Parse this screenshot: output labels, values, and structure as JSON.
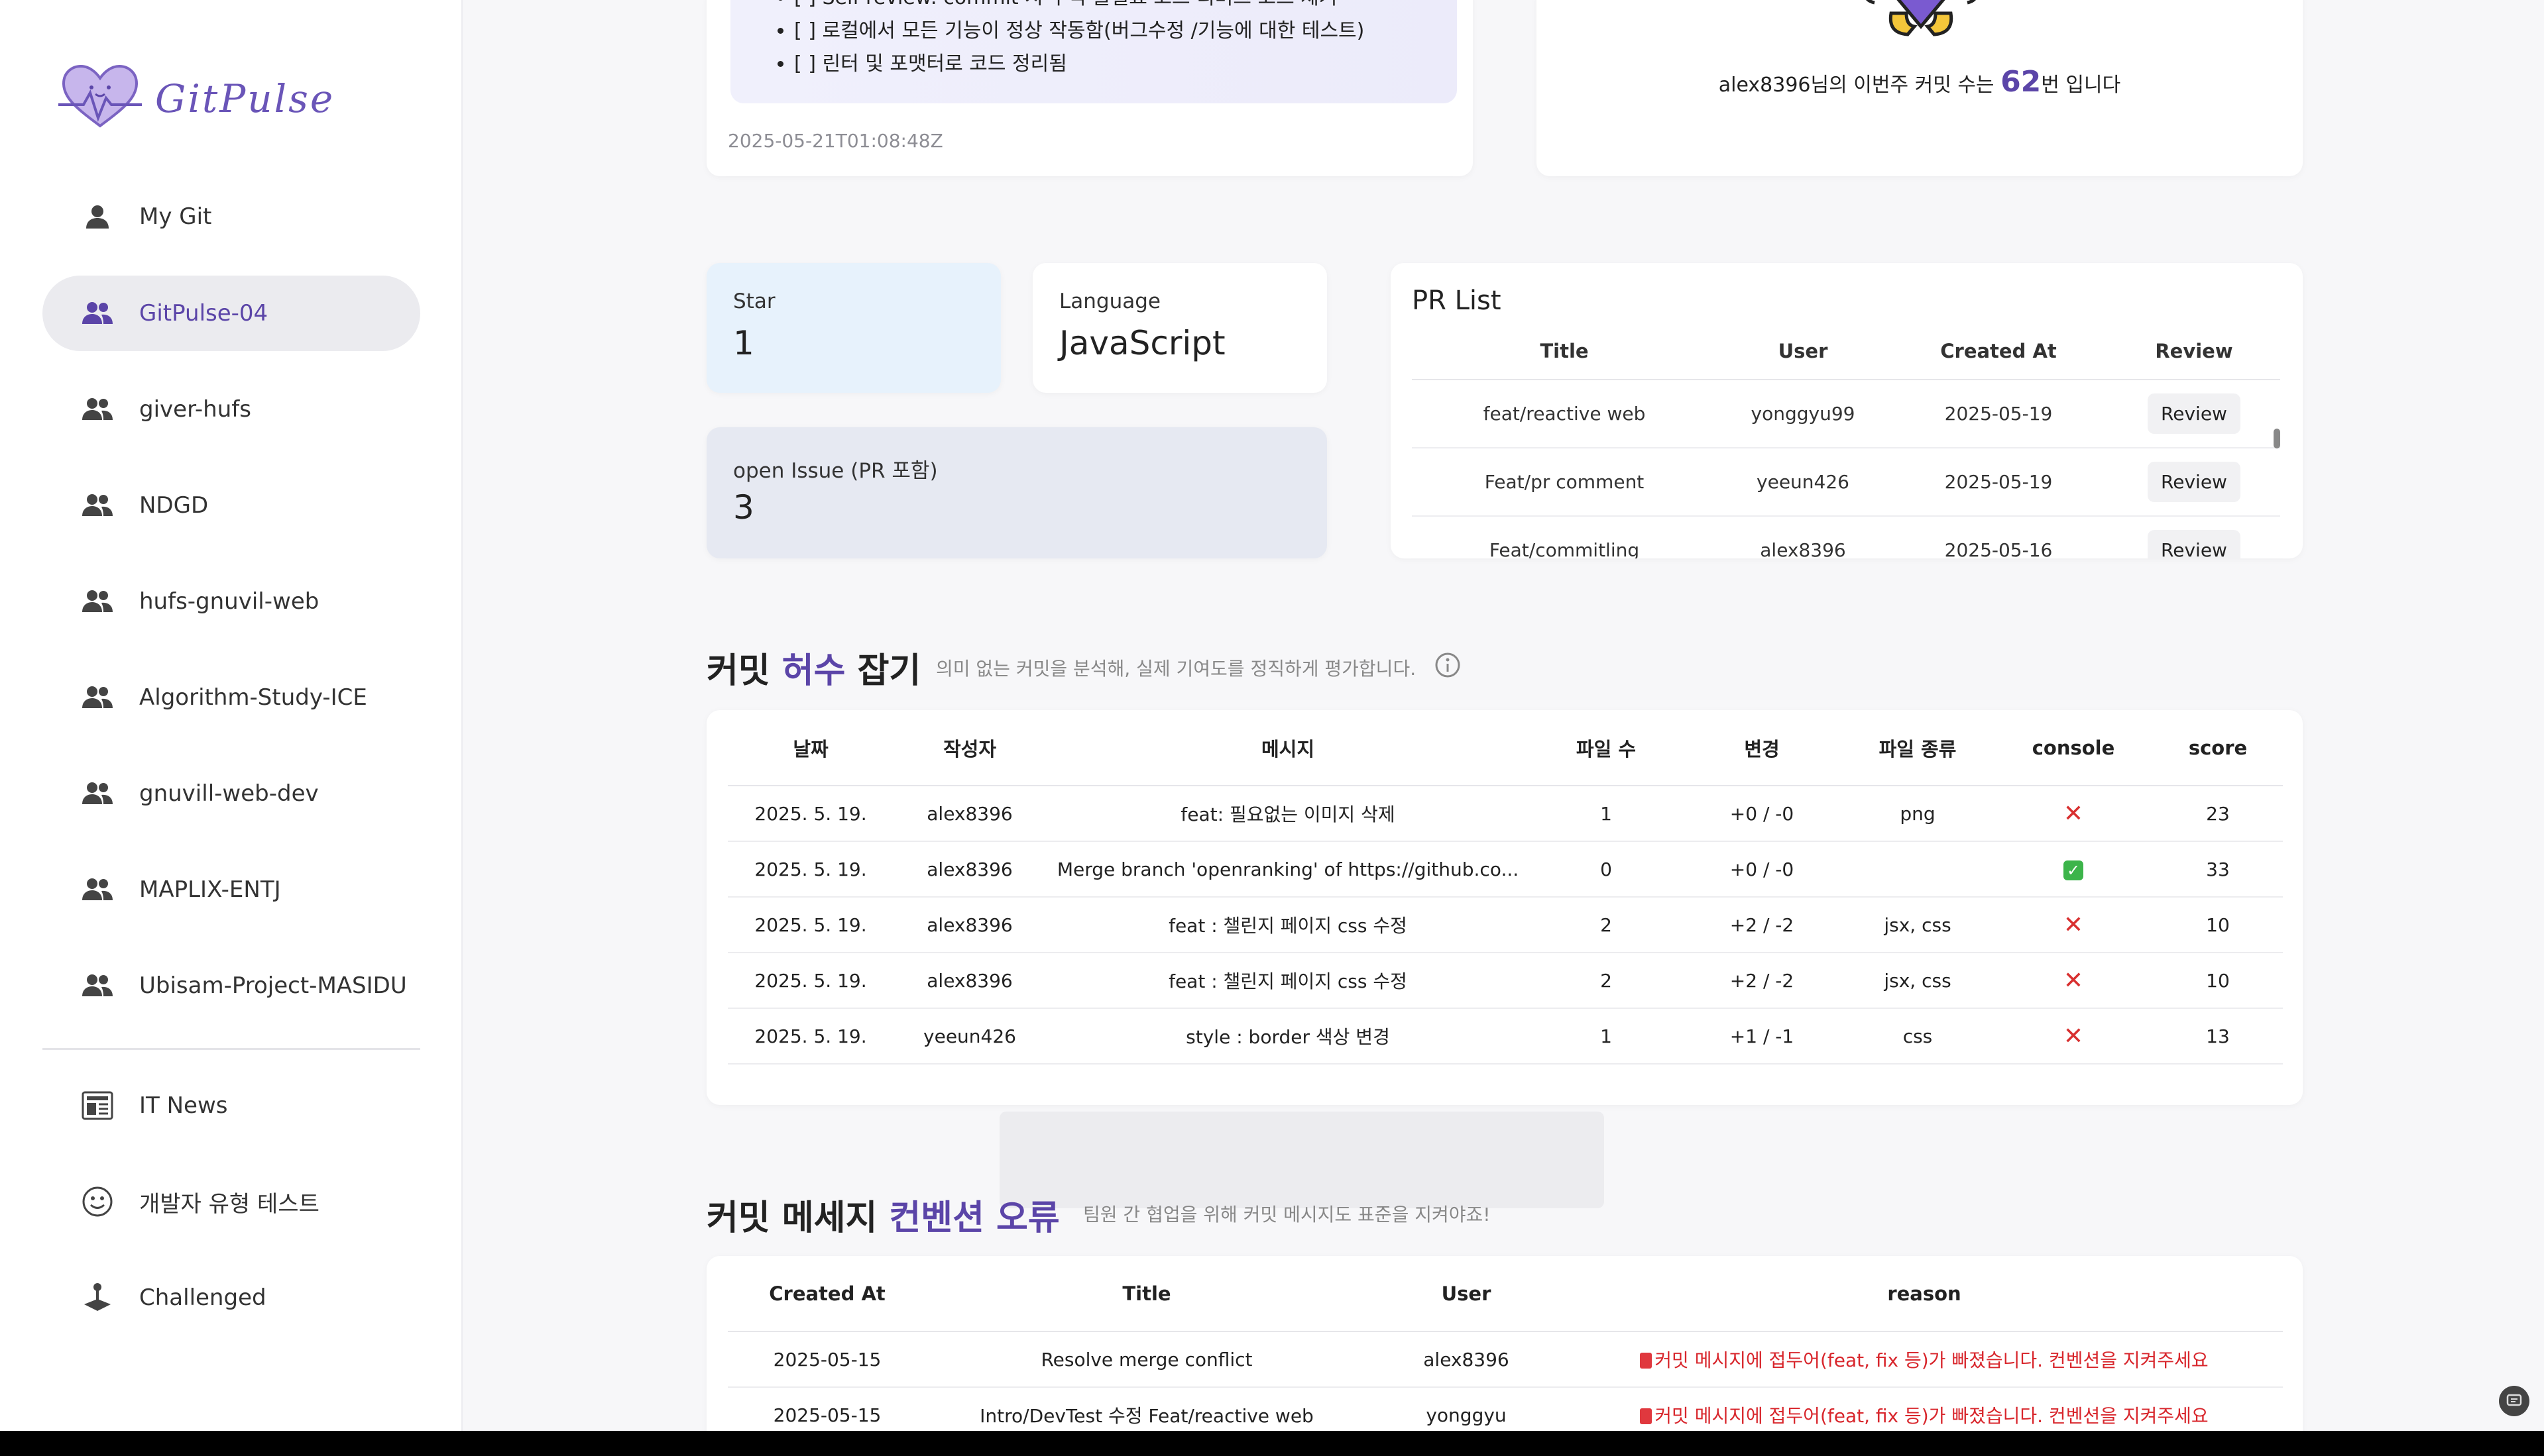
{
  "sidebar": {
    "logo_text": "GitPulse",
    "items": [
      {
        "label": "My Git",
        "icon": "person-icon"
      },
      {
        "label": "GitPulse-04",
        "icon": "group-icon",
        "active": true
      },
      {
        "label": "giver-hufs",
        "icon": "group-icon"
      },
      {
        "label": "NDGD",
        "icon": "group-icon"
      },
      {
        "label": "hufs-gnuvil-web",
        "icon": "group-icon"
      },
      {
        "label": "Algorithm-Study-ICE",
        "icon": "group-icon"
      },
      {
        "label": "gnuvill-web-dev",
        "icon": "group-icon"
      },
      {
        "label": "MAPLIX-ENTJ",
        "icon": "group-icon"
      },
      {
        "label": "Ubisam-Project-MASIDU",
        "icon": "group-icon"
      }
    ],
    "bottom_items": [
      {
        "label": "IT News",
        "icon": "newspaper-icon"
      },
      {
        "label": "개발자 유형 테스트",
        "icon": "smiley-icon"
      },
      {
        "label": "Challenged",
        "icon": "joystick-icon"
      }
    ]
  },
  "readme": {
    "lines": [
      "[ ] Self-review: commit 시 주석·불필요 코드·디버그 코드 제거",
      "[ ] 로컬에서 모든 기능이 정상 작동함(버그수정 /기능에 대한 테스트)",
      "[ ] 린터 및 포맷터로 코드 정리됨"
    ],
    "date": "2025-05-21T01:08:48Z"
  },
  "weekly_commit": {
    "user": "alex8396",
    "prefix": "님의 이번주 커밋 수는 ",
    "count": "62",
    "suffix": "번 입니다"
  },
  "stats": {
    "star_label": "Star",
    "star_value": "1",
    "language_label": "Language",
    "language_value": "JavaScript",
    "issue_label": "open Issue (PR 포함)",
    "issue_value": "3"
  },
  "pr_list": {
    "title": "PR List",
    "headers": [
      "Title",
      "User",
      "Created At",
      "Review"
    ],
    "rows": [
      {
        "title": "feat/reactive web",
        "user": "yonggyu99",
        "created": "2025-05-19",
        "review": "Review"
      },
      {
        "title": "Feat/pr comment",
        "user": "yeeun426",
        "created": "2025-05-19",
        "review": "Review"
      },
      {
        "title": "Feat/commitling",
        "user": "alex8396",
        "created": "2025-05-16",
        "review": "Review"
      }
    ]
  },
  "commit_section": {
    "title_a": "커밋 ",
    "title_accent": "허수",
    "title_b": " 잡기",
    "desc": "의미 없는 커밋을 분석해, 실제 기여도를 정직하게 평가합니다.",
    "headers": [
      "날짜",
      "작성자",
      "메시지",
      "파일 수",
      "변경",
      "파일 종류",
      "console",
      "score"
    ],
    "rows": [
      {
        "date": "2025. 5. 19.",
        "author": "alex8396",
        "message": "feat: 필요없는 이미지 삭제",
        "files": "1",
        "change": "+0 / -0",
        "types": "png",
        "console": "x",
        "score": "23"
      },
      {
        "date": "2025. 5. 19.",
        "author": "alex8396",
        "message": "Merge branch 'openranking' of https://github.co...",
        "files": "0",
        "change": "+0 / -0",
        "types": "",
        "console": "check",
        "score": "33"
      },
      {
        "date": "2025. 5. 19.",
        "author": "alex8396",
        "message": "feat : 챌린지 페이지 css 수정",
        "files": "2",
        "change": "+2 / -2",
        "types": "jsx, css",
        "console": "x",
        "score": "10"
      },
      {
        "date": "2025. 5. 19.",
        "author": "alex8396",
        "message": "feat : 챌린지 페이지 css 수정",
        "files": "2",
        "change": "+2 / -2",
        "types": "jsx, css",
        "console": "x",
        "score": "10"
      },
      {
        "date": "2025. 5. 19.",
        "author": "yeeun426",
        "message": "style : border 색상 변경",
        "files": "1",
        "change": "+1 / -1",
        "types": "css",
        "console": "x",
        "score": "13"
      }
    ]
  },
  "convention_section": {
    "title_a": "커밋 메세지 ",
    "title_accent": "컨벤션 오류",
    "desc": "팀원 간 협업을 위해 커밋 메시지도 표준을 지켜야죠!",
    "headers": [
      "Created At",
      "Title",
      "User",
      "reason"
    ],
    "rows": [
      {
        "created": "2025-05-15",
        "title": "Resolve merge conflict",
        "user": "alex8396",
        "reason": "커밋 메시지에 접두어(feat, fix 등)가 빠졌습니다. 컨벤션을 지켜주세요"
      },
      {
        "created": "2025-05-15",
        "title": "Intro/DevTest 수정 Feat/reactive web",
        "user": "yonggyu",
        "reason": "커밋 메시지에 접두어(feat, fix 등)가 빠졌습니다. 컨벤션을 지켜주세요"
      }
    ]
  },
  "colors": {
    "accent": "#5b45a8",
    "error": "#d8262c",
    "ok": "#3cb44a"
  }
}
